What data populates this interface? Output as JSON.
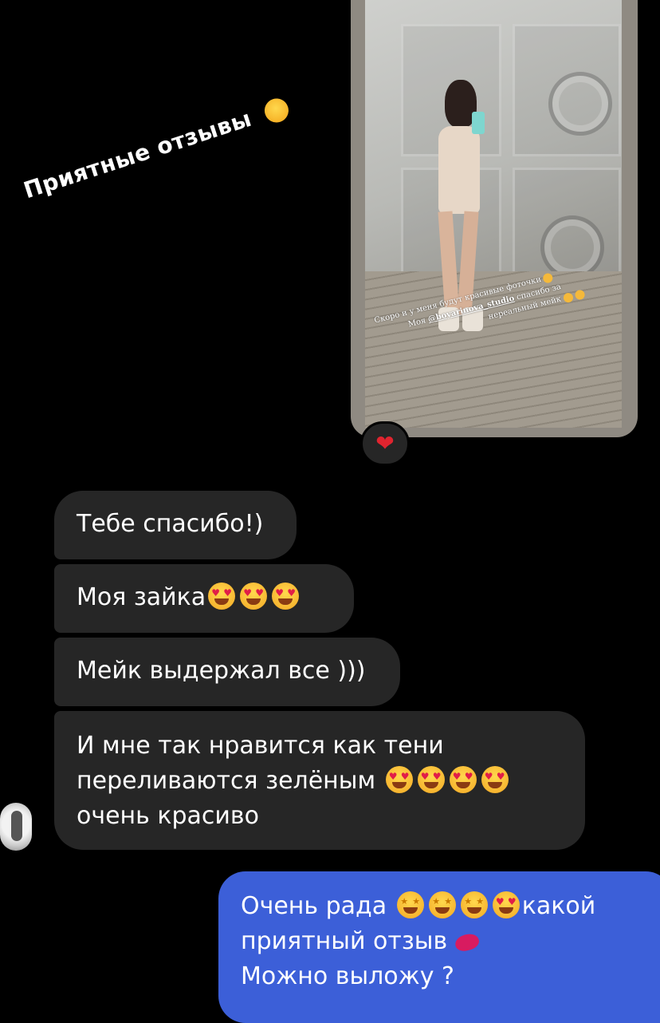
{
  "sticker": {
    "text": "Приятные отзывы",
    "emoji_icon": "smiling-face-with-hearts-icon"
  },
  "story_reply": {
    "caption_line1": "Скоро и у меня будут красивые фоточки",
    "caption_line2_prefix": "Моя",
    "caption_mention": "@boyarinova_studio",
    "caption_line2_suffix": "спасибо за",
    "caption_line3": "нереальный мейк",
    "reaction_icon": "red-heart-icon"
  },
  "messages_incoming": [
    {
      "text": "Тебе спасибо!)"
    },
    {
      "text": "Моя зайка",
      "emojis": [
        "heart-eyes-icon",
        "heart-eyes-icon",
        "heart-eyes-icon"
      ]
    },
    {
      "text": "Мейк выдержал все )))"
    },
    {
      "line1": "И мне так нравится как тени",
      "line2": "переливаются зелёным",
      "line2_emojis": [
        "heart-eyes-icon",
        "heart-eyes-icon",
        "heart-eyes-icon",
        "heart-eyes-icon"
      ],
      "line3": "очень красиво"
    }
  ],
  "message_outgoing": {
    "line1_prefix": "Очень рада",
    "line1_emojis": [
      "star-struck-icon",
      "star-struck-icon",
      "star-struck-icon",
      "heart-eyes-icon"
    ],
    "line1_suffix": "какой",
    "line2": "приятный отзыв",
    "line2_emoji": "kiss-mark-icon",
    "line3": "Можно выложу ?"
  },
  "colors": {
    "background": "#000000",
    "incoming_bubble": "#262626",
    "outgoing_bubble": "#3c5fd8",
    "reaction_heart": "#e0242f"
  }
}
